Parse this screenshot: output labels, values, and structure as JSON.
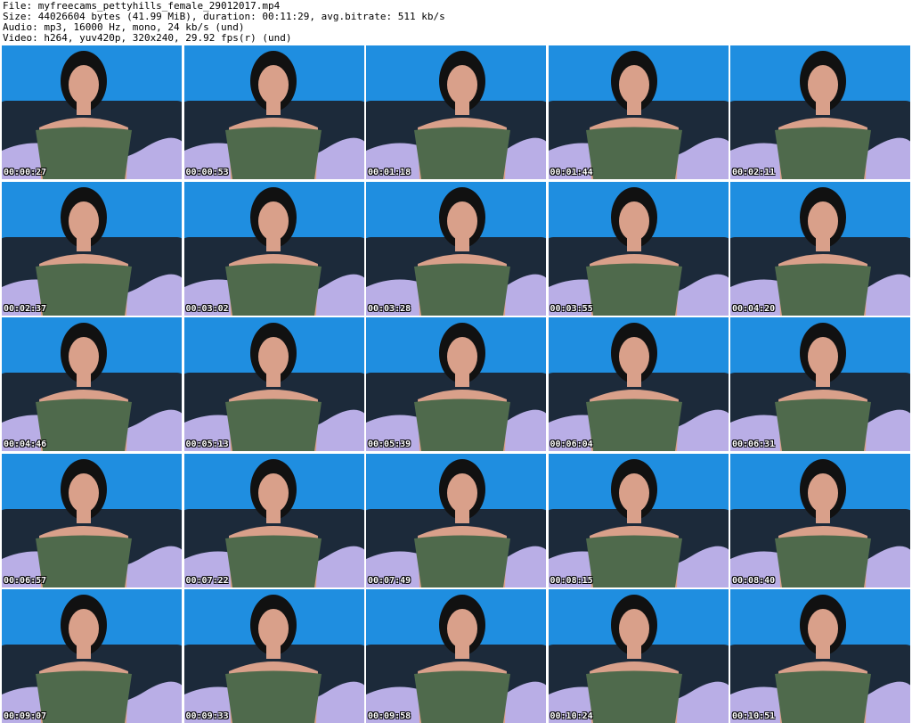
{
  "header": {
    "file_line": "File: myfreecams_pettyhills_female_29012017.mp4",
    "size_line": "Size: 44026604 bytes (41.99 MiB), duration: 00:11:29, avg.bitrate: 511 kb/s",
    "audio_line": "Audio: mp3, 16000 Hz, mono, 24 kb/s (und)",
    "video_line": "Video: h264, yuv420p, 320x240, 29.92 fps(r) (und)"
  },
  "thumbnails": [
    {
      "timestamp": "00:00:27"
    },
    {
      "timestamp": "00:00:53"
    },
    {
      "timestamp": "00:01:18"
    },
    {
      "timestamp": "00:01:44"
    },
    {
      "timestamp": "00:02:11"
    },
    {
      "timestamp": "00:02:37"
    },
    {
      "timestamp": "00:03:02"
    },
    {
      "timestamp": "00:03:28"
    },
    {
      "timestamp": "00:03:55"
    },
    {
      "timestamp": "00:04:20"
    },
    {
      "timestamp": "00:04:46"
    },
    {
      "timestamp": "00:05:13"
    },
    {
      "timestamp": "00:05:39"
    },
    {
      "timestamp": "00:06:04"
    },
    {
      "timestamp": "00:06:31"
    },
    {
      "timestamp": "00:06:57"
    },
    {
      "timestamp": "00:07:22"
    },
    {
      "timestamp": "00:07:49"
    },
    {
      "timestamp": "00:08:15"
    },
    {
      "timestamp": "00:08:40"
    },
    {
      "timestamp": "00:09:07"
    },
    {
      "timestamp": "00:09:33"
    },
    {
      "timestamp": "00:09:58"
    },
    {
      "timestamp": "00:10:24"
    },
    {
      "timestamp": "00:10:51"
    }
  ],
  "colors": {
    "wall_blue": "#1f8ee0",
    "couch": "#1c2a3a",
    "blanket": "#b9aee6",
    "skin": "#d9a08a",
    "top_green": "#4f6a4c",
    "hair": "#111111"
  }
}
